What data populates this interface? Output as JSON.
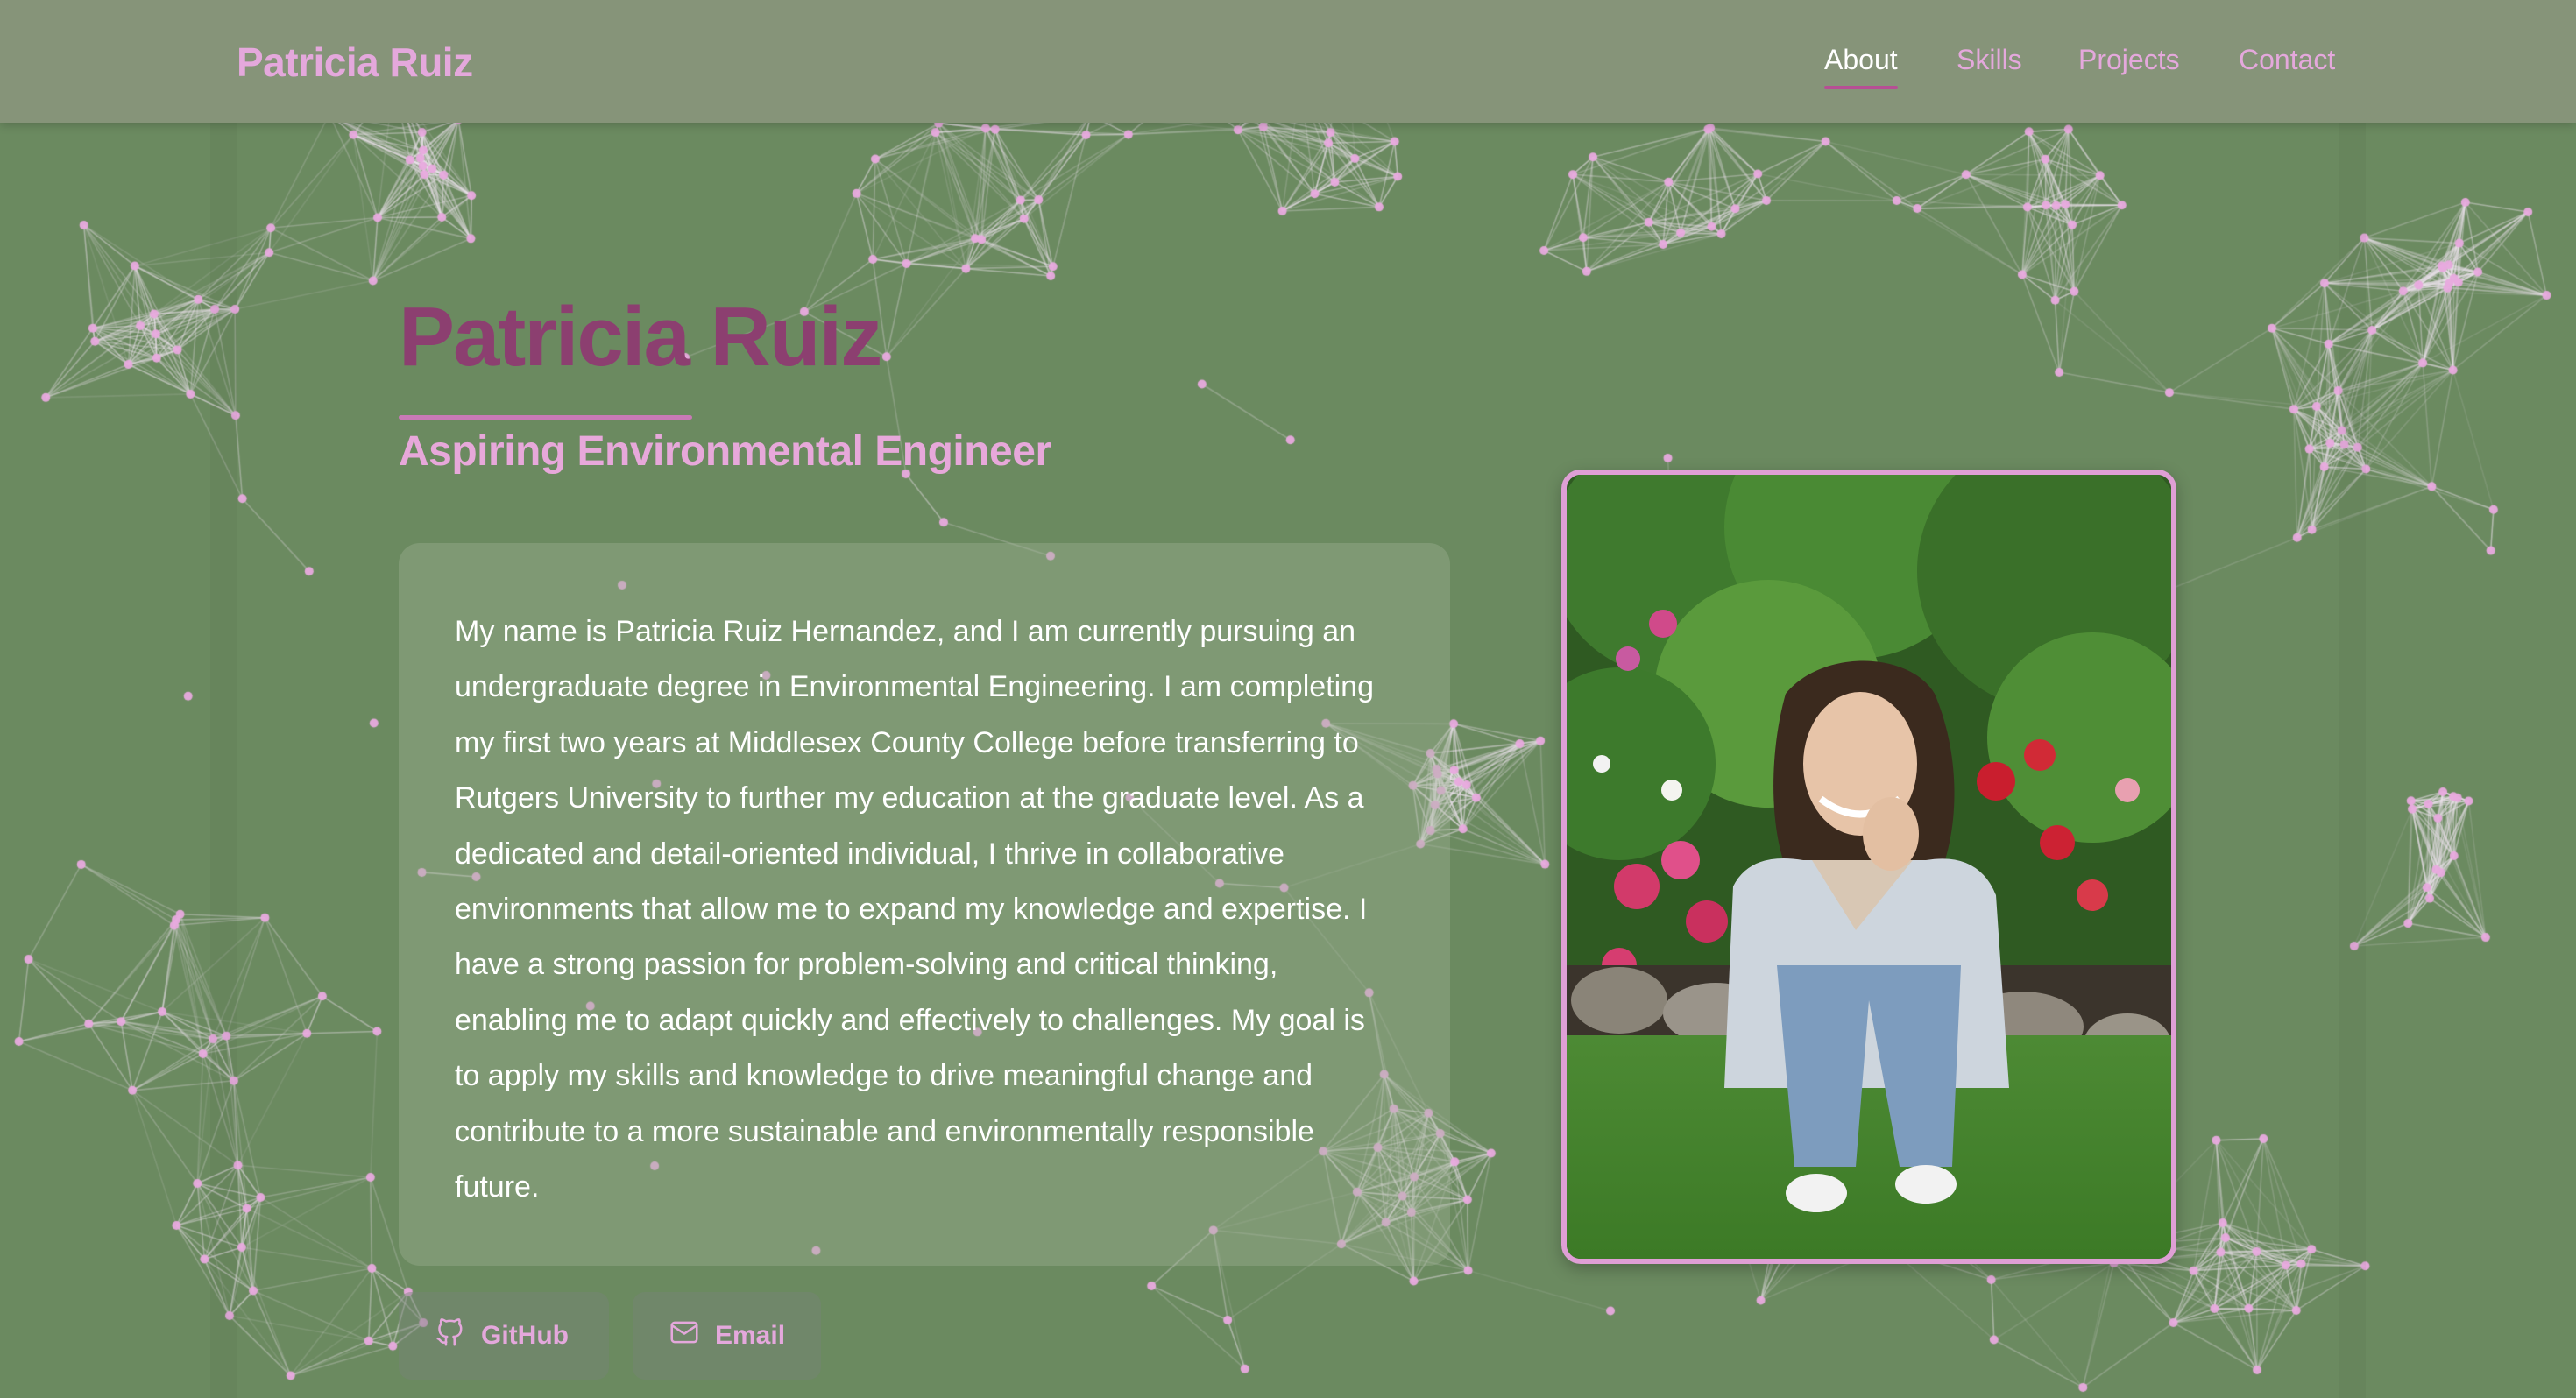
{
  "navbar": {
    "brand": "Patricia Ruiz",
    "links": [
      {
        "label": "About",
        "active": true
      },
      {
        "label": "Skills",
        "active": false
      },
      {
        "label": "Projects",
        "active": false
      },
      {
        "label": "Contact",
        "active": false
      }
    ]
  },
  "hero": {
    "name": "Patricia Ruiz",
    "subtitle": "Aspiring Environmental Engineer",
    "bio": "My name is Patricia Ruiz Hernandez, and I am currently pursuing an undergraduate degree in Environmental Engineering. I am completing my first two years at Middlesex County College before transferring to Rutgers University to further my education at the graduate level. As a dedicated and detail-oriented individual, I thrive in collaborative environments that allow me to expand my knowledge and expertise. I have a strong passion for problem-solving and critical thinking, enabling me to adapt quickly and effectively to challenges. My goal is to apply my skills and knowledge to drive meaningful change and contribute to a more sustainable and environmentally responsible future.",
    "buttons": [
      {
        "label": "GitHub",
        "icon": "github-icon"
      },
      {
        "label": "Email",
        "icon": "mail-icon"
      }
    ]
  },
  "colors": {
    "background": "#6b8a60",
    "navbar": "#869479",
    "accent_pink": "#e4a8dc",
    "title_plum": "#8c3f70",
    "underline": "#b64f94"
  }
}
